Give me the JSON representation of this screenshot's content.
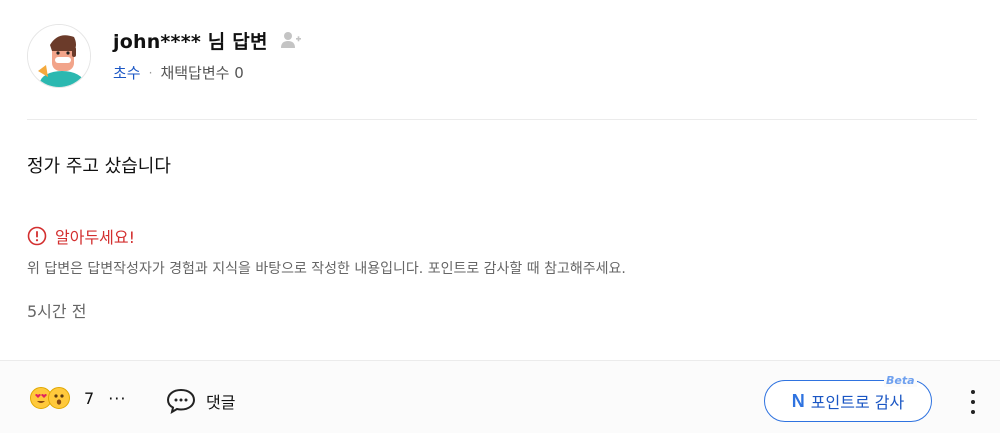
{
  "answer": {
    "author": "john**** 님 답변",
    "rank": "초수",
    "meta_separator": "·",
    "adopted_count_label": "채택답변수 0",
    "body": "정가 주고 샀습니다",
    "notice_title": "알아두세요!",
    "notice_text": "위 답변은 답변작성자가 경험과 지식을 바탕으로 작성한 내용입니다. 포인트로 감사할 때 참고해주세요.",
    "time_ago": "5시간 전"
  },
  "footer": {
    "reaction_count": "7",
    "reaction_more": "···",
    "comment_label": "댓글",
    "point_button_label": "포인트로 감사",
    "point_icon_letter": "N",
    "beta_badge": "Beta"
  },
  "icons": {
    "avatar": "character-avatar",
    "add_friend": "add-friend-icon",
    "warning": "warning-circle-icon",
    "emoji_1": "heart-eyes-emoji-icon",
    "emoji_2": "surprised-emoji-icon",
    "comment": "speech-bubble-icon",
    "more": "kebab-menu-icon"
  },
  "colors": {
    "rank": "#1a56c4",
    "warning": "#d32f2f",
    "point_accent": "#2f73e0"
  }
}
